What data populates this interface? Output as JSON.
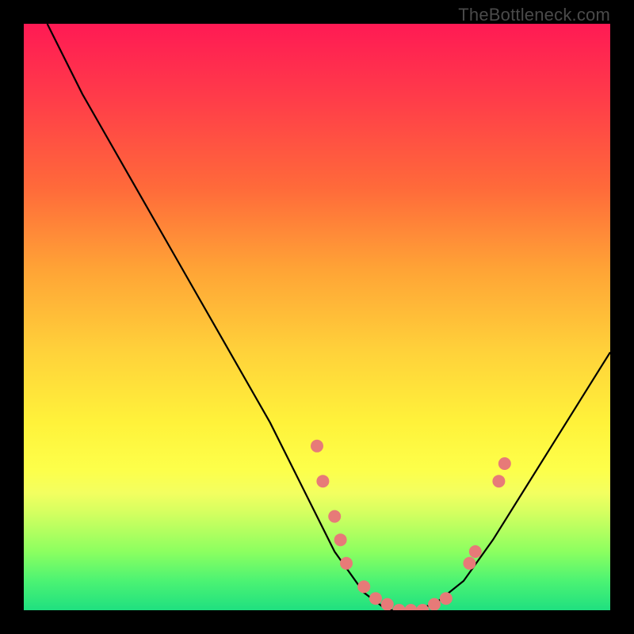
{
  "watermark": "TheBottleneck.com",
  "chart_data": {
    "type": "line",
    "title": "",
    "xlabel": "",
    "ylabel": "",
    "xlim": [
      0,
      100
    ],
    "ylim": [
      0,
      100
    ],
    "grid": false,
    "legend": false,
    "series": [
      {
        "name": "curve",
        "x": [
          4,
          10,
          18,
          26,
          34,
          42,
          48,
          53,
          58,
          62,
          66,
          70,
          75,
          80,
          85,
          90,
          95,
          100
        ],
        "y": [
          100,
          88,
          74,
          60,
          46,
          32,
          20,
          10,
          3,
          0,
          0,
          1,
          5,
          12,
          20,
          28,
          36,
          44
        ]
      }
    ],
    "points": [
      {
        "x": 50,
        "y": 28
      },
      {
        "x": 51,
        "y": 22
      },
      {
        "x": 53,
        "y": 16
      },
      {
        "x": 54,
        "y": 12
      },
      {
        "x": 55,
        "y": 8
      },
      {
        "x": 58,
        "y": 4
      },
      {
        "x": 60,
        "y": 2
      },
      {
        "x": 62,
        "y": 1
      },
      {
        "x": 64,
        "y": 0
      },
      {
        "x": 66,
        "y": 0
      },
      {
        "x": 68,
        "y": 0
      },
      {
        "x": 70,
        "y": 1
      },
      {
        "x": 72,
        "y": 2
      },
      {
        "x": 76,
        "y": 8
      },
      {
        "x": 77,
        "y": 10
      },
      {
        "x": 81,
        "y": 22
      },
      {
        "x": 82,
        "y": 25
      }
    ],
    "gradient_stops": [
      {
        "pos": 0.0,
        "color": "#ff1a54"
      },
      {
        "pos": 0.5,
        "color": "#ffd23a"
      },
      {
        "pos": 0.8,
        "color": "#f3ff60"
      },
      {
        "pos": 1.0,
        "color": "#1fe080"
      }
    ]
  }
}
